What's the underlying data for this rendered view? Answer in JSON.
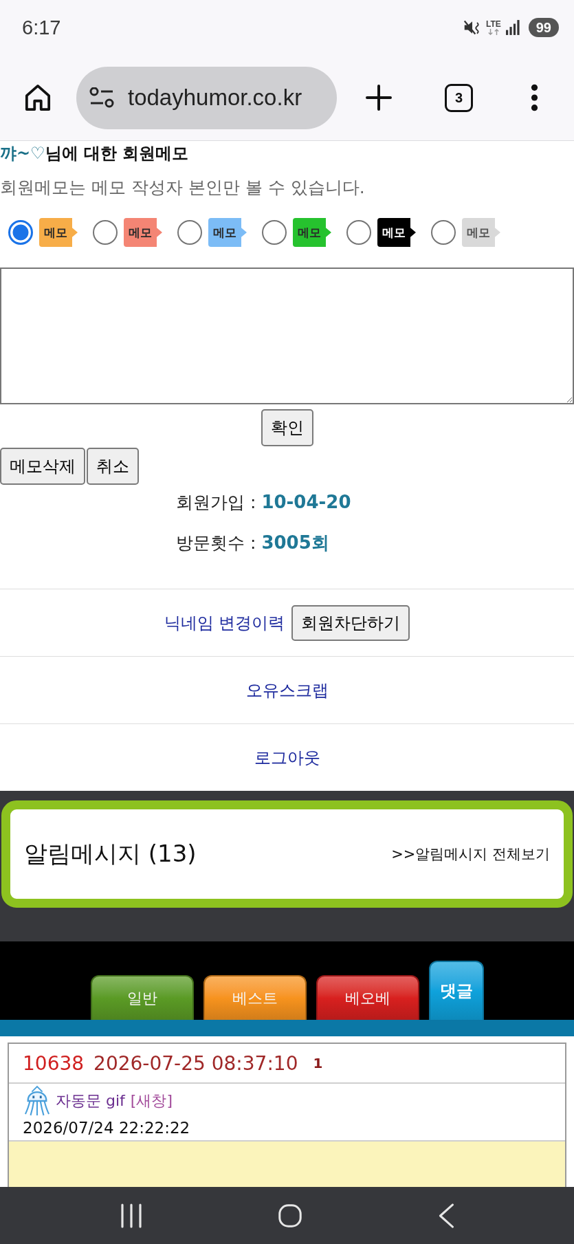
{
  "status_bar": {
    "time": "6:17",
    "network": "LTE",
    "battery": "99"
  },
  "browser": {
    "url": "todayhumor.co.kr",
    "tab_count": "3"
  },
  "memo": {
    "nickname": "꺄~♡",
    "heading": "님에 대한 회원메모",
    "notice": "회원메모는 메모 작성자 본인만 볼 수 있습니다.",
    "options": [
      {
        "label": "메모",
        "color": "#f7ad48",
        "selected": true
      },
      {
        "label": "메모",
        "color": "#f48574",
        "selected": false
      },
      {
        "label": "메모",
        "color": "#7cbcf6",
        "selected": false
      },
      {
        "label": "메모",
        "color": "#26c22e",
        "selected": false
      },
      {
        "label": "메모",
        "color": "#000000",
        "selected": false
      },
      {
        "label": "메모",
        "color": "#d9d9d9",
        "selected": false
      }
    ],
    "confirm_button": "확인",
    "delete_button": "메모삭제",
    "cancel_button": "취소"
  },
  "member_info": [
    {
      "label": "회원가입 :",
      "value": "10-04-20"
    },
    {
      "label": "방문횟수 :",
      "value": "3005회"
    }
  ],
  "actions": {
    "nickname_history": "닉네임 변경이력",
    "block_button": "회원차단하기",
    "scrap": "오유스크랩",
    "logout": "로그아웃"
  },
  "notifications": {
    "title": "알림메시지 (13)",
    "view_all": ">>알림메시지 전체보기"
  },
  "board_tabs": [
    {
      "label": "일반",
      "color": "#5b9b25",
      "selected": false
    },
    {
      "label": "베스트",
      "color": "#f7931e",
      "selected": false
    },
    {
      "label": "베오베",
      "color": "#d8201f",
      "selected": false
    },
    {
      "label": "댓글",
      "color": "#0fa2dc",
      "selected": true
    }
  ],
  "comment": {
    "number": "10638",
    "datetime": "2026-07-25 08:37:10",
    "count": "1",
    "title": "자동문 gif",
    "new_window": "[새창]",
    "posted": "2026/07/24 22:22:22"
  }
}
